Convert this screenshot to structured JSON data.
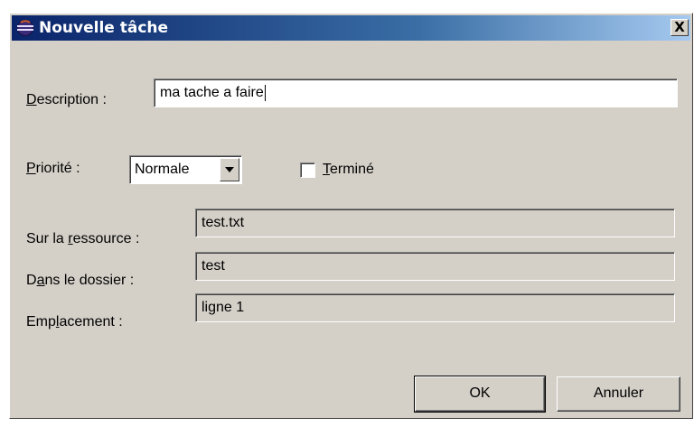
{
  "window": {
    "title": "Nouvelle tâche",
    "close_label": "X",
    "icon": "eclipse-app-icon"
  },
  "form": {
    "description": {
      "label_pre": "",
      "label_mnemonic": "D",
      "label_post": "escription :",
      "value": "ma tache a faire"
    },
    "priority": {
      "label_pre": "",
      "label_mnemonic": "P",
      "label_post": "riorité :",
      "value": "Normale"
    },
    "done": {
      "label_pre": "",
      "label_mnemonic": "T",
      "label_post": "erminé",
      "checked": false
    },
    "resource": {
      "label_pre": "Sur la ",
      "label_mnemonic": "r",
      "label_post": "essource :",
      "value": "test.txt"
    },
    "folder": {
      "label_pre": "D",
      "label_mnemonic": "a",
      "label_post": "ns le dossier :",
      "value": "test"
    },
    "location": {
      "label_pre": "Emp",
      "label_mnemonic": "l",
      "label_post": "acement :",
      "value": "ligne 1"
    }
  },
  "buttons": {
    "ok": "OK",
    "cancel": "Annuler"
  },
  "colors": {
    "dialog_bg": "#d4d0c8",
    "title_start": "#0a246a",
    "title_end": "#a6caf0"
  }
}
